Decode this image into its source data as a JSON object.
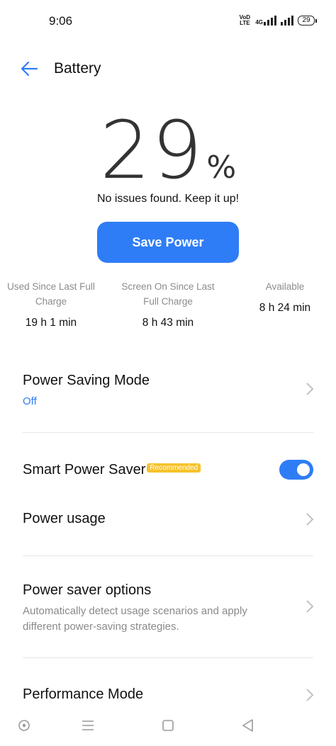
{
  "status_bar": {
    "time": "9:06",
    "volte_top": "VoD",
    "volte_bottom": "LTE",
    "network": "4G",
    "battery_level": "29"
  },
  "header": {
    "title": "Battery",
    "back_icon": "arrow-left-icon"
  },
  "battery": {
    "percent": "29",
    "percent_sign": "%",
    "status_message": "No issues found. Keep it up!",
    "save_button_label": "Save Power"
  },
  "stats": [
    {
      "label": "Used Since Last Full Charge",
      "value": "19 h 1 min"
    },
    {
      "label": "Screen On Since Last Full Charge",
      "value": "8 h 43 min"
    },
    {
      "label": "Available",
      "value": "8 h 24 min"
    }
  ],
  "settings": {
    "power_saving_mode": {
      "title": "Power Saving Mode",
      "status": "Off"
    },
    "smart_power_saver": {
      "title": "Smart Power Saver",
      "badge": "Recommended",
      "enabled": true
    },
    "power_usage": {
      "title": "Power usage"
    },
    "power_saver_options": {
      "title": "Power saver options",
      "description": "Automatically detect usage scenarios and apply different power-saving strategies."
    },
    "performance_mode": {
      "title": "Performance Mode"
    }
  },
  "colors": {
    "accent": "#2f7df6",
    "badge": "#f7c22a",
    "secondary_text": "#8a8a8a"
  },
  "nav_bar": {
    "icons": [
      "circle-icon",
      "menu-icon",
      "square-icon",
      "back-triangle-icon"
    ]
  }
}
